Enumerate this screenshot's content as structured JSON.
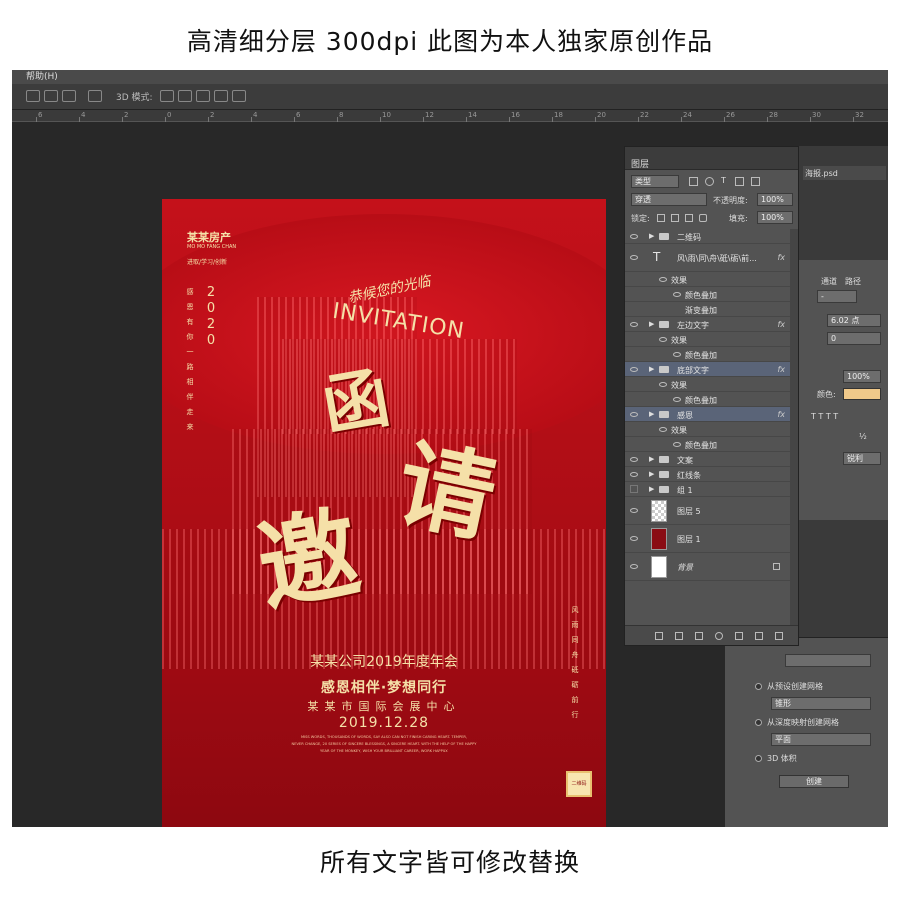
{
  "captions": {
    "top": "高清细分层  300dpi  此图为本人独家原创作品",
    "bottom": "所有文字皆可修改替换"
  },
  "menubar": {
    "help": "帮助(H)"
  },
  "optionsbar": {
    "mode_label": "3D 模式:"
  },
  "ruler": {
    "ticks": [
      "6",
      "4",
      "2",
      "0",
      "2",
      "4",
      "6",
      "8",
      "10",
      "12",
      "14",
      "16",
      "18",
      "20",
      "22",
      "24",
      "26",
      "28",
      "30",
      "32"
    ]
  },
  "poster": {
    "brand": "某某房产",
    "brand_en": "MO MO FANG CHAN",
    "slogan": "进取/学习/创新",
    "year": "2020",
    "left_vertical": "感恩有你一路相伴走来",
    "right_vertical": "风雨同舟砥砺前行",
    "greeting": "恭候您的光临",
    "invitation_en": "INVITATION",
    "title_han": "函",
    "title_qing": "请",
    "title_yao": "邀",
    "event": "某某公司2019年度年会",
    "theme": "感恩相伴·梦想同行",
    "venue": "某某市国际会展中心",
    "date": "2019.12.28",
    "small_lines": [
      "MISS WORDS, THOUSANDS OF WORDS, SAY ALSO CAN NOT FINISH CARING HEART. TEMPER,",
      "NEVER CHANGE, 20 SERIES OF SINCERE BLESSINGS, A SINCERE HEART. WITH THE HELP OF THE HAPPY",
      "YEAR OF THE MONKEY, WISH YOUR BRILLIANT CAREER, WORK HAPPILY."
    ],
    "qr_label": "二维码"
  },
  "layers_panel": {
    "tab": "图层",
    "filter_select": "类型",
    "blend_mode": "穿透",
    "opacity_label": "不透明度:",
    "opacity_value": "100%",
    "lock_label": "锁定:",
    "fill_label": "填充:",
    "fill_value": "100%",
    "fx": "fx",
    "layers": [
      {
        "name": "二维码"
      },
      {
        "name": "风\\雨\\同\\舟\\砥\\砺\\前..."
      },
      {
        "name": "效果"
      },
      {
        "name": "颜色叠加"
      },
      {
        "name": "渐变叠加"
      },
      {
        "name": "左边文字"
      },
      {
        "name": "效果"
      },
      {
        "name": "颜色叠加"
      },
      {
        "name": "底部文字"
      },
      {
        "name": "效果"
      },
      {
        "name": "颜色叠加"
      },
      {
        "name": "感恩"
      },
      {
        "name": "效果"
      },
      {
        "name": "颜色叠加"
      },
      {
        "name": "文案"
      },
      {
        "name": "红线条"
      },
      {
        "name": "组 1"
      },
      {
        "name": "图层 5"
      },
      {
        "name": "图层 1"
      },
      {
        "name": "背景"
      }
    ]
  },
  "right_panels": {
    "doc_title": "海报.psd",
    "tab_channels": "通道",
    "tab_paths": "路径",
    "leading": "6.02 点",
    "tracking": "0",
    "scale": "100%",
    "color_label": "颜色:",
    "text_color": "#f0c98a",
    "anti_alias": "锐利",
    "glyphs": "T  T  T  T",
    "fraction": "½",
    "dash": "-"
  },
  "threed_panel": {
    "opt_preset": "从预设创建网格",
    "preset_value": "锥形",
    "opt_depth": "从深度映射创建网格",
    "depth_value": "平面",
    "opt_volume": "3D 体积",
    "create_button": "创建"
  }
}
